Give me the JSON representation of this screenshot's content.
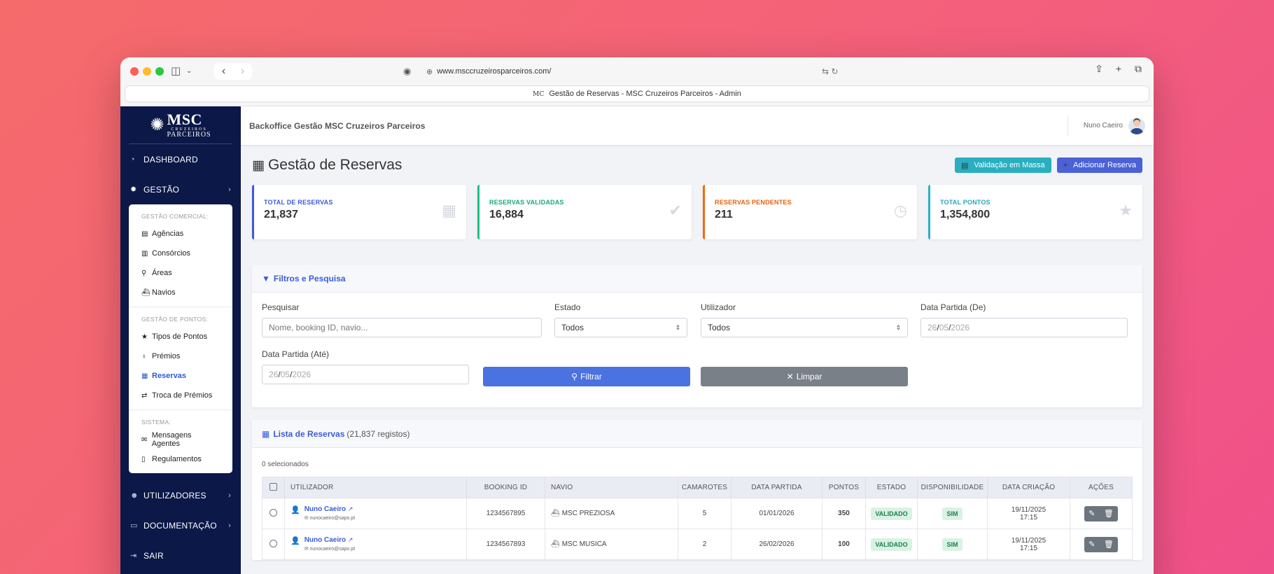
{
  "browser": {
    "url": "www.msccruzeirosparceiros.com/",
    "tab_title": "Gestão de Reservas - MSC Cruzeiros Parceiros - Admin",
    "tab_favicon": "MC"
  },
  "logo": {
    "brand": "MSC",
    "line1": "CRUZEIROS",
    "line2": "PARCEIROS"
  },
  "sidebar": {
    "dashboard": "DASHBOARD",
    "gestao": "GESTÃO",
    "comercial_head": "GESTÃO COMERCIAL:",
    "comercial_items": [
      "Agências",
      "Consórcios",
      "Áreas",
      "Navios"
    ],
    "pontos_head": "GESTÃO DE PONTOS:",
    "pontos_items": [
      "Tipos de Pontos",
      "Prémios",
      "Reservas",
      "Troca de Prémios"
    ],
    "sistema_head": "SISTEMA:",
    "sistema_items": [
      "Mensagens Agentes",
      "Regulamentos"
    ],
    "utilizadores": "UTILIZADORES",
    "documentacao": "DOCUMENTAÇÃO",
    "sair": "SAIR"
  },
  "topbar": {
    "title": "Backoffice Gestão MSC Cruzeiros Parceiros",
    "user": "Nuno Caeiro"
  },
  "page": {
    "title": "Gestão de Reservas",
    "btn_mass": "Validação em Massa",
    "btn_add": "Adicionar Reserva"
  },
  "stats": [
    {
      "label": "TOTAL DE RESERVAS",
      "value": "21,837"
    },
    {
      "label": "RESERVAS VALIDADAS",
      "value": "16,884"
    },
    {
      "label": "RESERVAS PENDENTES",
      "value": "211"
    },
    {
      "label": "TOTAL PONTOS",
      "value": "1,354,800"
    }
  ],
  "filters": {
    "title": "Filtros e Pesquisa",
    "search_label": "Pesquisar",
    "search_placeholder": "Nome, booking ID, navio...",
    "estado_label": "Estado",
    "estado_value": "Todos",
    "utilizador_label": "Utilizador",
    "utilizador_value": "Todos",
    "data_de_label": "Data Partida (De)",
    "data_ate_label": "Data Partida (Até)",
    "date_day": "26",
    "date_month": "05",
    "date_year": "2026",
    "btn_filter": "Filtrar",
    "btn_clear": "Limpar"
  },
  "list": {
    "title": "Lista de Reservas",
    "count": "(21,837 registos)",
    "selected": "0 selecionados",
    "columns": [
      "UTILIZADOR",
      "BOOKING ID",
      "NAVIO",
      "CAMAROTES",
      "DATA PARTIDA",
      "PONTOS",
      "ESTADO",
      "DISPONIBILIDADE",
      "DATA CRIAÇÃO",
      "AÇÕES"
    ],
    "rows": [
      {
        "name": "Nuno Caeiro",
        "email": "nunocaeiro@sapo.pt",
        "booking": "1234567895",
        "ship": "MSC PREZIOSA",
        "cabins": "5",
        "date": "01/01/2026",
        "points": "350",
        "status": "VALIDADO",
        "avail": "SIM",
        "created_date": "19/11/2025",
        "created_time": "17:15"
      },
      {
        "name": "Nuno Caeiro",
        "email": "nunocaeiro@sapo.pt",
        "booking": "1234567893",
        "ship": "MSC MUSICA",
        "cabins": "2",
        "date": "26/02/2026",
        "points": "100",
        "status": "VALIDADO",
        "avail": "SIM",
        "created_date": "19/11/2025",
        "created_time": "17:15"
      }
    ]
  },
  "colors": {
    "sidebar": "#0b1848",
    "accent": "#3b5bd9",
    "teal": "#2aaec0",
    "gray": "#7a8088"
  }
}
